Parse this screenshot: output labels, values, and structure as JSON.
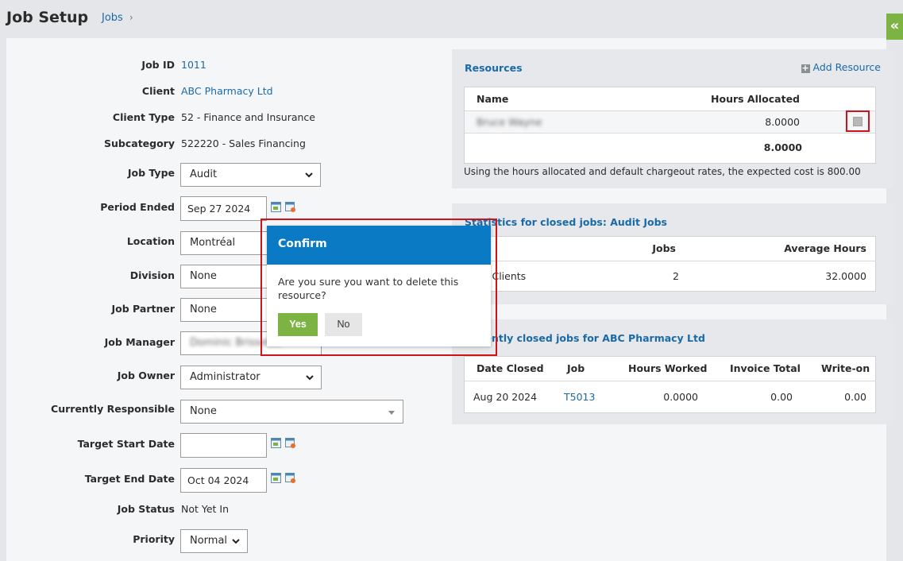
{
  "header": {
    "title": "Job Setup",
    "breadcrumb": "Jobs",
    "breadcrumb_sep": "›",
    "collapse_glyph": "«"
  },
  "form": {
    "job_id": {
      "label": "Job ID",
      "value": "1011"
    },
    "client": {
      "label": "Client",
      "value": "ABC Pharmacy Ltd"
    },
    "client_type": {
      "label": "Client Type",
      "value": "52 - Finance and Insurance"
    },
    "subcategory": {
      "label": "Subcategory",
      "value": "522220 - Sales Financing"
    },
    "job_type": {
      "label": "Job Type",
      "value": "Audit"
    },
    "period_ended": {
      "label": "Period Ended",
      "value": "Sep 27 2024"
    },
    "location": {
      "label": "Location",
      "value": "Montréal"
    },
    "division": {
      "label": "Division",
      "value": "None"
    },
    "job_partner": {
      "label": "Job Partner",
      "value": "None"
    },
    "job_manager": {
      "label": "Job Manager",
      "value": "Dominic Brissette"
    },
    "job_owner": {
      "label": "Job Owner",
      "value": "Administrator"
    },
    "currently_responsible": {
      "label": "Currently Responsible",
      "value": "None"
    },
    "target_start_date": {
      "label": "Target Start Date",
      "value": ""
    },
    "target_end_date": {
      "label": "Target End Date",
      "value": "Oct 04 2024"
    },
    "job_status": {
      "label": "Job Status",
      "value": "Not Yet In"
    },
    "priority": {
      "label": "Priority",
      "value": "Normal"
    }
  },
  "resources": {
    "title": "Resources",
    "add_label": "Add Resource",
    "col_name": "Name",
    "col_hours": "Hours Allocated",
    "rows": [
      {
        "name": "Bruce Wayne",
        "hours": "8.0000"
      }
    ],
    "total": "8.0000",
    "note": "Using the hours allocated and default chargeout rates, the expected cost is 800.00"
  },
  "statistics": {
    "title": "Statistics for closed jobs: Audit Jobs",
    "col_jobs": "Jobs",
    "col_avg": "Average Hours",
    "row_label": "All Clients",
    "jobs": "2",
    "avg_hours": "32.0000"
  },
  "recent": {
    "title": "Recently closed jobs for ABC Pharmacy Ltd",
    "cols": [
      "Date Closed",
      "Job",
      "Hours Worked",
      "Invoice Total",
      "Write-on"
    ],
    "rows": [
      {
        "date": "Aug 20 2024",
        "job": "T5013",
        "hours": "0.0000",
        "invoice": "0.00",
        "writeon": "0.00"
      }
    ]
  },
  "dialog": {
    "title": "Confirm",
    "message": "Are you sure you want to delete this resource?",
    "yes": "Yes",
    "no": "No"
  },
  "colors": {
    "accent": "#0a7ac4",
    "link": "#1a6aa8",
    "yes_green": "#7cb342",
    "highlight_red": "#d0121b"
  }
}
